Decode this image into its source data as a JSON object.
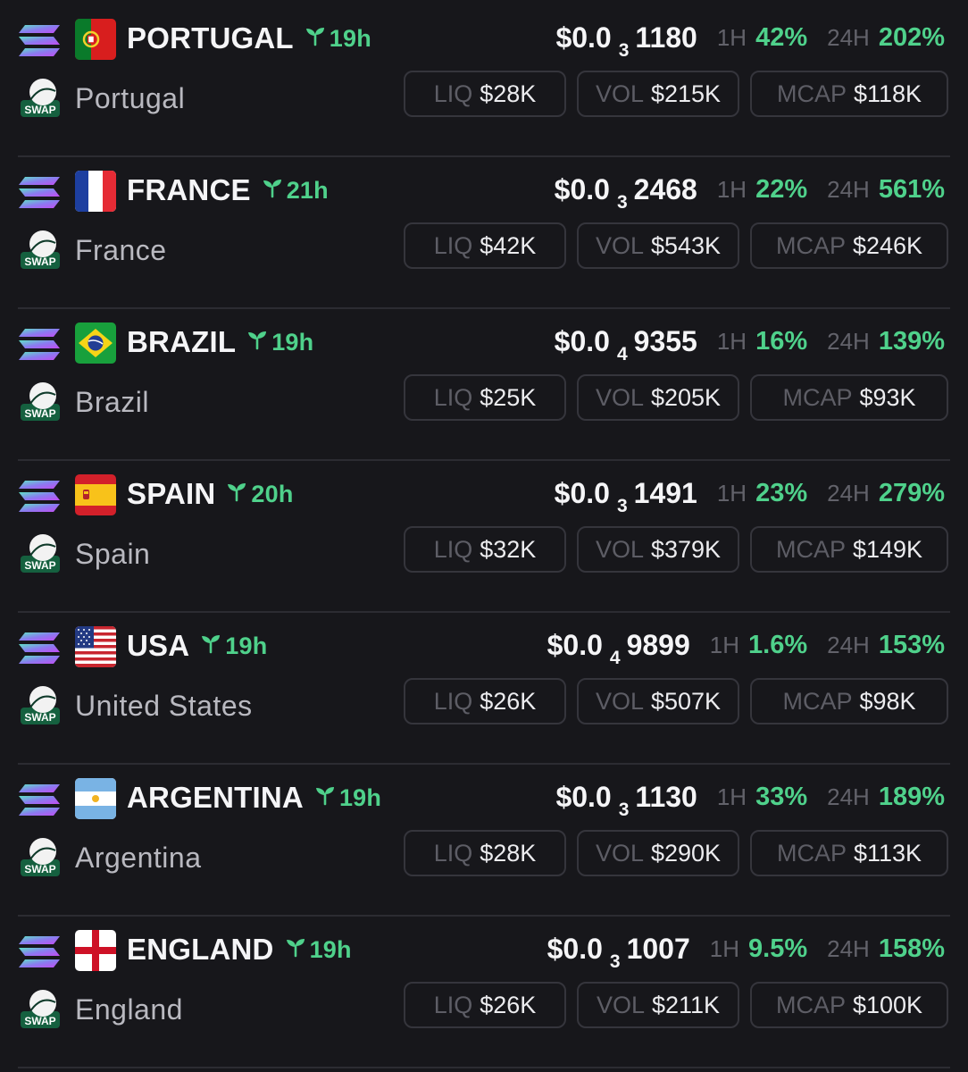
{
  "labels": {
    "h1": "1H",
    "h24": "24H",
    "liq": "LIQ",
    "vol": "VOL",
    "mcap": "MCAP",
    "swap": "SWAP"
  },
  "colors": {
    "background": "#17171b",
    "accent_green": "#4fd18b",
    "muted": "#62626a"
  },
  "tokens": [
    {
      "symbol": "PORTUGAL",
      "name": "Portugal",
      "age": "19h",
      "flag": "portugal-flag",
      "price_prefix": "$0.0",
      "price_zeros": "3",
      "price_digits": "1180",
      "change_1h": "42%",
      "change_24h": "202%",
      "liq": "$28K",
      "vol": "$215K",
      "mcap": "$118K"
    },
    {
      "symbol": "FRANCE",
      "name": "France",
      "age": "21h",
      "flag": "france-flag",
      "price_prefix": "$0.0",
      "price_zeros": "3",
      "price_digits": "2468",
      "change_1h": "22%",
      "change_24h": "561%",
      "liq": "$42K",
      "vol": "$543K",
      "mcap": "$246K"
    },
    {
      "symbol": "BRAZIL",
      "name": "Brazil",
      "age": "19h",
      "flag": "brazil-flag",
      "price_prefix": "$0.0",
      "price_zeros": "4",
      "price_digits": "9355",
      "change_1h": "16%",
      "change_24h": "139%",
      "liq": "$25K",
      "vol": "$205K",
      "mcap": "$93K"
    },
    {
      "symbol": "SPAIN",
      "name": "Spain",
      "age": "20h",
      "flag": "spain-flag",
      "price_prefix": "$0.0",
      "price_zeros": "3",
      "price_digits": "1491",
      "change_1h": "23%",
      "change_24h": "279%",
      "liq": "$32K",
      "vol": "$379K",
      "mcap": "$149K"
    },
    {
      "symbol": "USA",
      "name": "United States",
      "age": "19h",
      "flag": "usa-flag",
      "price_prefix": "$0.0",
      "price_zeros": "4",
      "price_digits": "9899",
      "change_1h": "1.6%",
      "change_24h": "153%",
      "liq": "$26K",
      "vol": "$507K",
      "mcap": "$98K"
    },
    {
      "symbol": "ARGENTINA",
      "name": "Argentina",
      "age": "19h",
      "flag": "argentina-flag",
      "price_prefix": "$0.0",
      "price_zeros": "3",
      "price_digits": "1130",
      "change_1h": "33%",
      "change_24h": "189%",
      "liq": "$28K",
      "vol": "$290K",
      "mcap": "$113K"
    },
    {
      "symbol": "ENGLAND",
      "name": "England",
      "age": "19h",
      "flag": "england-flag",
      "price_prefix": "$0.0",
      "price_zeros": "3",
      "price_digits": "1007",
      "change_1h": "9.5%",
      "change_24h": "158%",
      "liq": "$26K",
      "vol": "$211K",
      "mcap": "$100K"
    }
  ]
}
